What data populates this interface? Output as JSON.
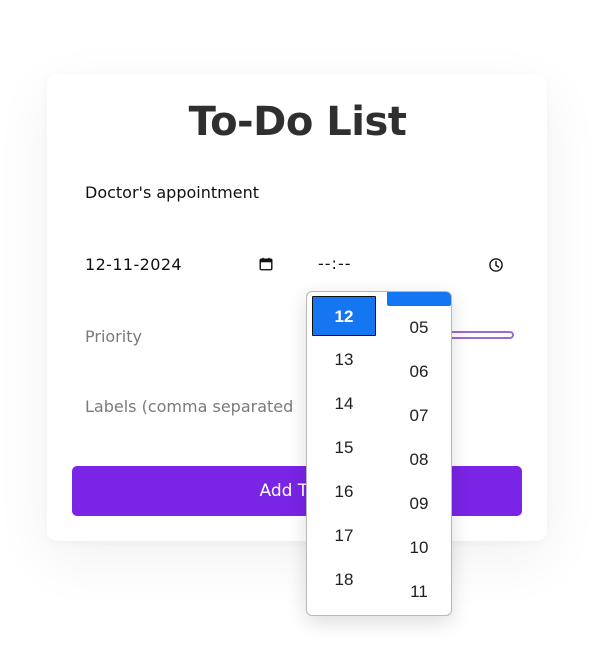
{
  "page": {
    "title": "To-Do List"
  },
  "form": {
    "task_text": "Doctor's appointment",
    "date_value": "12-11-2024",
    "time_value": "--:--",
    "priority_label": "Priority",
    "labels_placeholder": "Labels (comma separated",
    "submit_label": "Add Task"
  },
  "time_picker": {
    "hours": [
      "12",
      "13",
      "14",
      "15",
      "16",
      "17",
      "18"
    ],
    "selected_hour": "12",
    "minutes": [
      "05",
      "06",
      "07",
      "08",
      "09",
      "10",
      "11"
    ]
  },
  "icons": {
    "calendar": "calendar-icon",
    "clock": "clock-icon"
  },
  "colors": {
    "accent": "#7a24e6",
    "selection": "#1576f2",
    "range_border": "#9d68d8",
    "title": "#2f2f2f"
  }
}
